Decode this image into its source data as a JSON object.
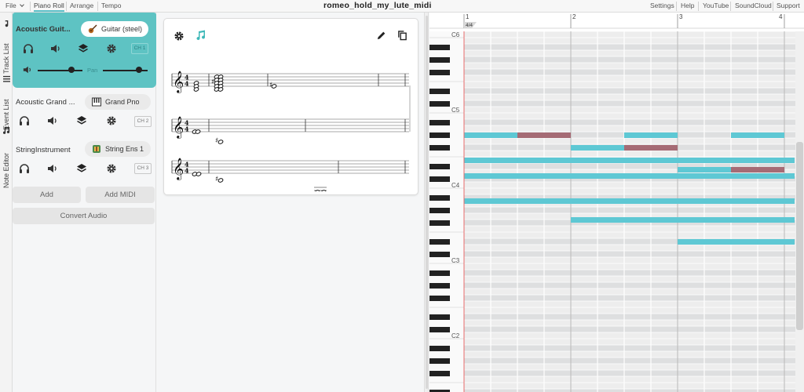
{
  "menu": {
    "file": "File",
    "tabs": [
      "Piano Roll",
      "Arrange",
      "Tempo"
    ],
    "selected_tab": "Piano Roll",
    "right_links": [
      "Settings",
      "Help",
      "YouTube",
      "SoundCloud",
      "Support"
    ]
  },
  "document_title": "romeo_hold_my_lute_midi",
  "side_tabs": [
    "Track List",
    "Event List",
    "Note Editor"
  ],
  "tracks": [
    {
      "name": "Acoustic Guit...",
      "instrument": "Guitar (steel)",
      "channel": "CH 1",
      "active": true,
      "pan_label": "Pan",
      "volume": 0.75,
      "pan": 0.8
    },
    {
      "name": "Acoustic Grand ...",
      "instrument": "Grand Pno",
      "channel": "CH 2",
      "active": false
    },
    {
      "name": "StringInstrument",
      "instrument": "String Ens 1",
      "channel": "CH 3",
      "active": false
    }
  ],
  "buttons": {
    "add": "Add",
    "add_midi": "Add MIDI",
    "convert_audio": "Convert Audio"
  },
  "pianoroll": {
    "time_signature": "4/4",
    "measures": [
      "1",
      "2",
      "3",
      "4"
    ],
    "key_labels": [
      "C6",
      "C5",
      "C4",
      "C3",
      "C2"
    ],
    "colors": {
      "selected_note": "#5ec8d4",
      "other_note": "#a56b75",
      "playhead": "#e86a6a",
      "accent": "#5ec3c3"
    }
  }
}
